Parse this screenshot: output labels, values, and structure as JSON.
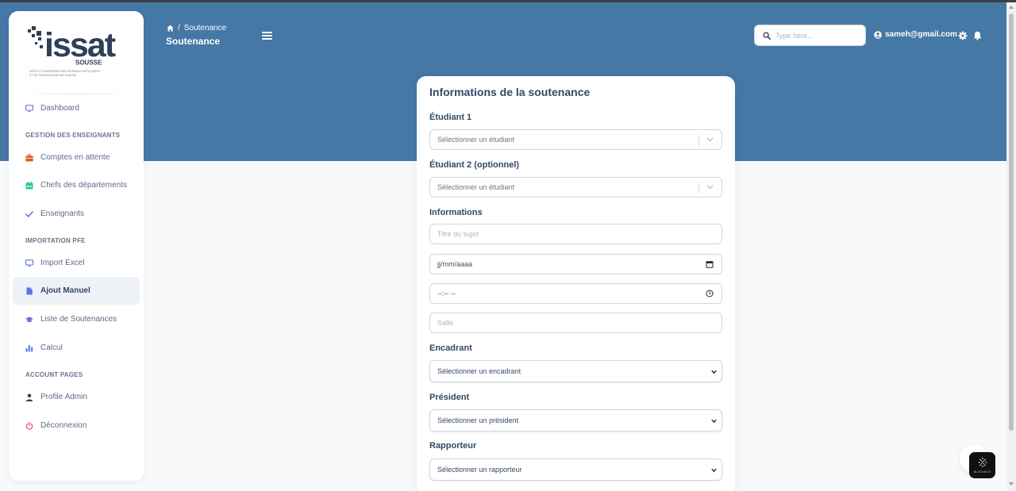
{
  "sidebar": {
    "logo": {
      "brand": "issat",
      "city": "SOUSSE",
      "caption_line1": "INSTITUT SUPÉRIEUR DES SCIENCES APPLIQUÉES",
      "caption_line2": "ET DE TECHNOLOGIE DE SOUSSE"
    },
    "dashboard": "Dashboard",
    "section_enseignants": "GESTION DES ENSEIGNANTS",
    "comptes": "Comptes en attente",
    "chefs": "Chefs des départements",
    "enseignants": "Enseignants",
    "section_pfe": "IMPORTATION PFE",
    "import_excel": "Import Excel",
    "ajout_manuel": "Ajout Manuel",
    "liste": "Liste de Soutenances",
    "calcul": "Calcul",
    "section_account": "ACCOUNT PAGES",
    "profile": "Profile Admin",
    "deconnexion": "Déconnexion"
  },
  "header": {
    "breadcrumb_sep": "/",
    "breadcrumb_current": "Soutenance",
    "page_title": "Soutenance",
    "search_placeholder": "Type here...",
    "user_email": "sameh@gmail.com"
  },
  "form": {
    "title": "Informations de la soutenance",
    "etudiant1_label": "Étudiant 1",
    "etudiant1_placeholder": "Sélectionner un étudiant",
    "etudiant2_label": "Étudiant 2 (optionnel)",
    "etudiant2_placeholder": "Sélectionner un étudiant",
    "informations_label": "Informations",
    "titre_placeholder": "Titre du sujet",
    "date_value": "jj/mm/aaaa",
    "time_value": "--:-- --",
    "salle_placeholder": "Salle",
    "encadrant_label": "Encadrant",
    "encadrant_value": "Sélectionner un encadrant",
    "president_label": "Président",
    "president_value": "Sélectionner un président",
    "rapporteur_label": "Rapporteur",
    "rapporteur_value": "Sélectionner un rapporteur"
  },
  "fab": {
    "label": "BLACKBOX"
  },
  "colors": {
    "hero": "#4578a5",
    "text_dark": "#344767",
    "text_muted": "#67748e",
    "icon_comptes": "#e8552f",
    "icon_chefs": "#2dce89",
    "icon_blue": "#5e72e4",
    "icon_red": "#f5365c"
  },
  "icons": {
    "home": "home-icon",
    "menu": "hamburger-icon",
    "search": "search-icon",
    "user": "user-circle-icon",
    "settings": "gear-icon",
    "notifications": "bell-icon",
    "dashboard": "monitor-icon",
    "comptes": "briefcase-icon",
    "chefs": "calendar-icon",
    "enseignants": "check-icon",
    "import": "monitor-icon",
    "ajout": "document-icon",
    "liste": "graduation-cap-icon",
    "calcul": "bar-chart-icon",
    "profile": "user-icon",
    "logout": "power-icon"
  }
}
